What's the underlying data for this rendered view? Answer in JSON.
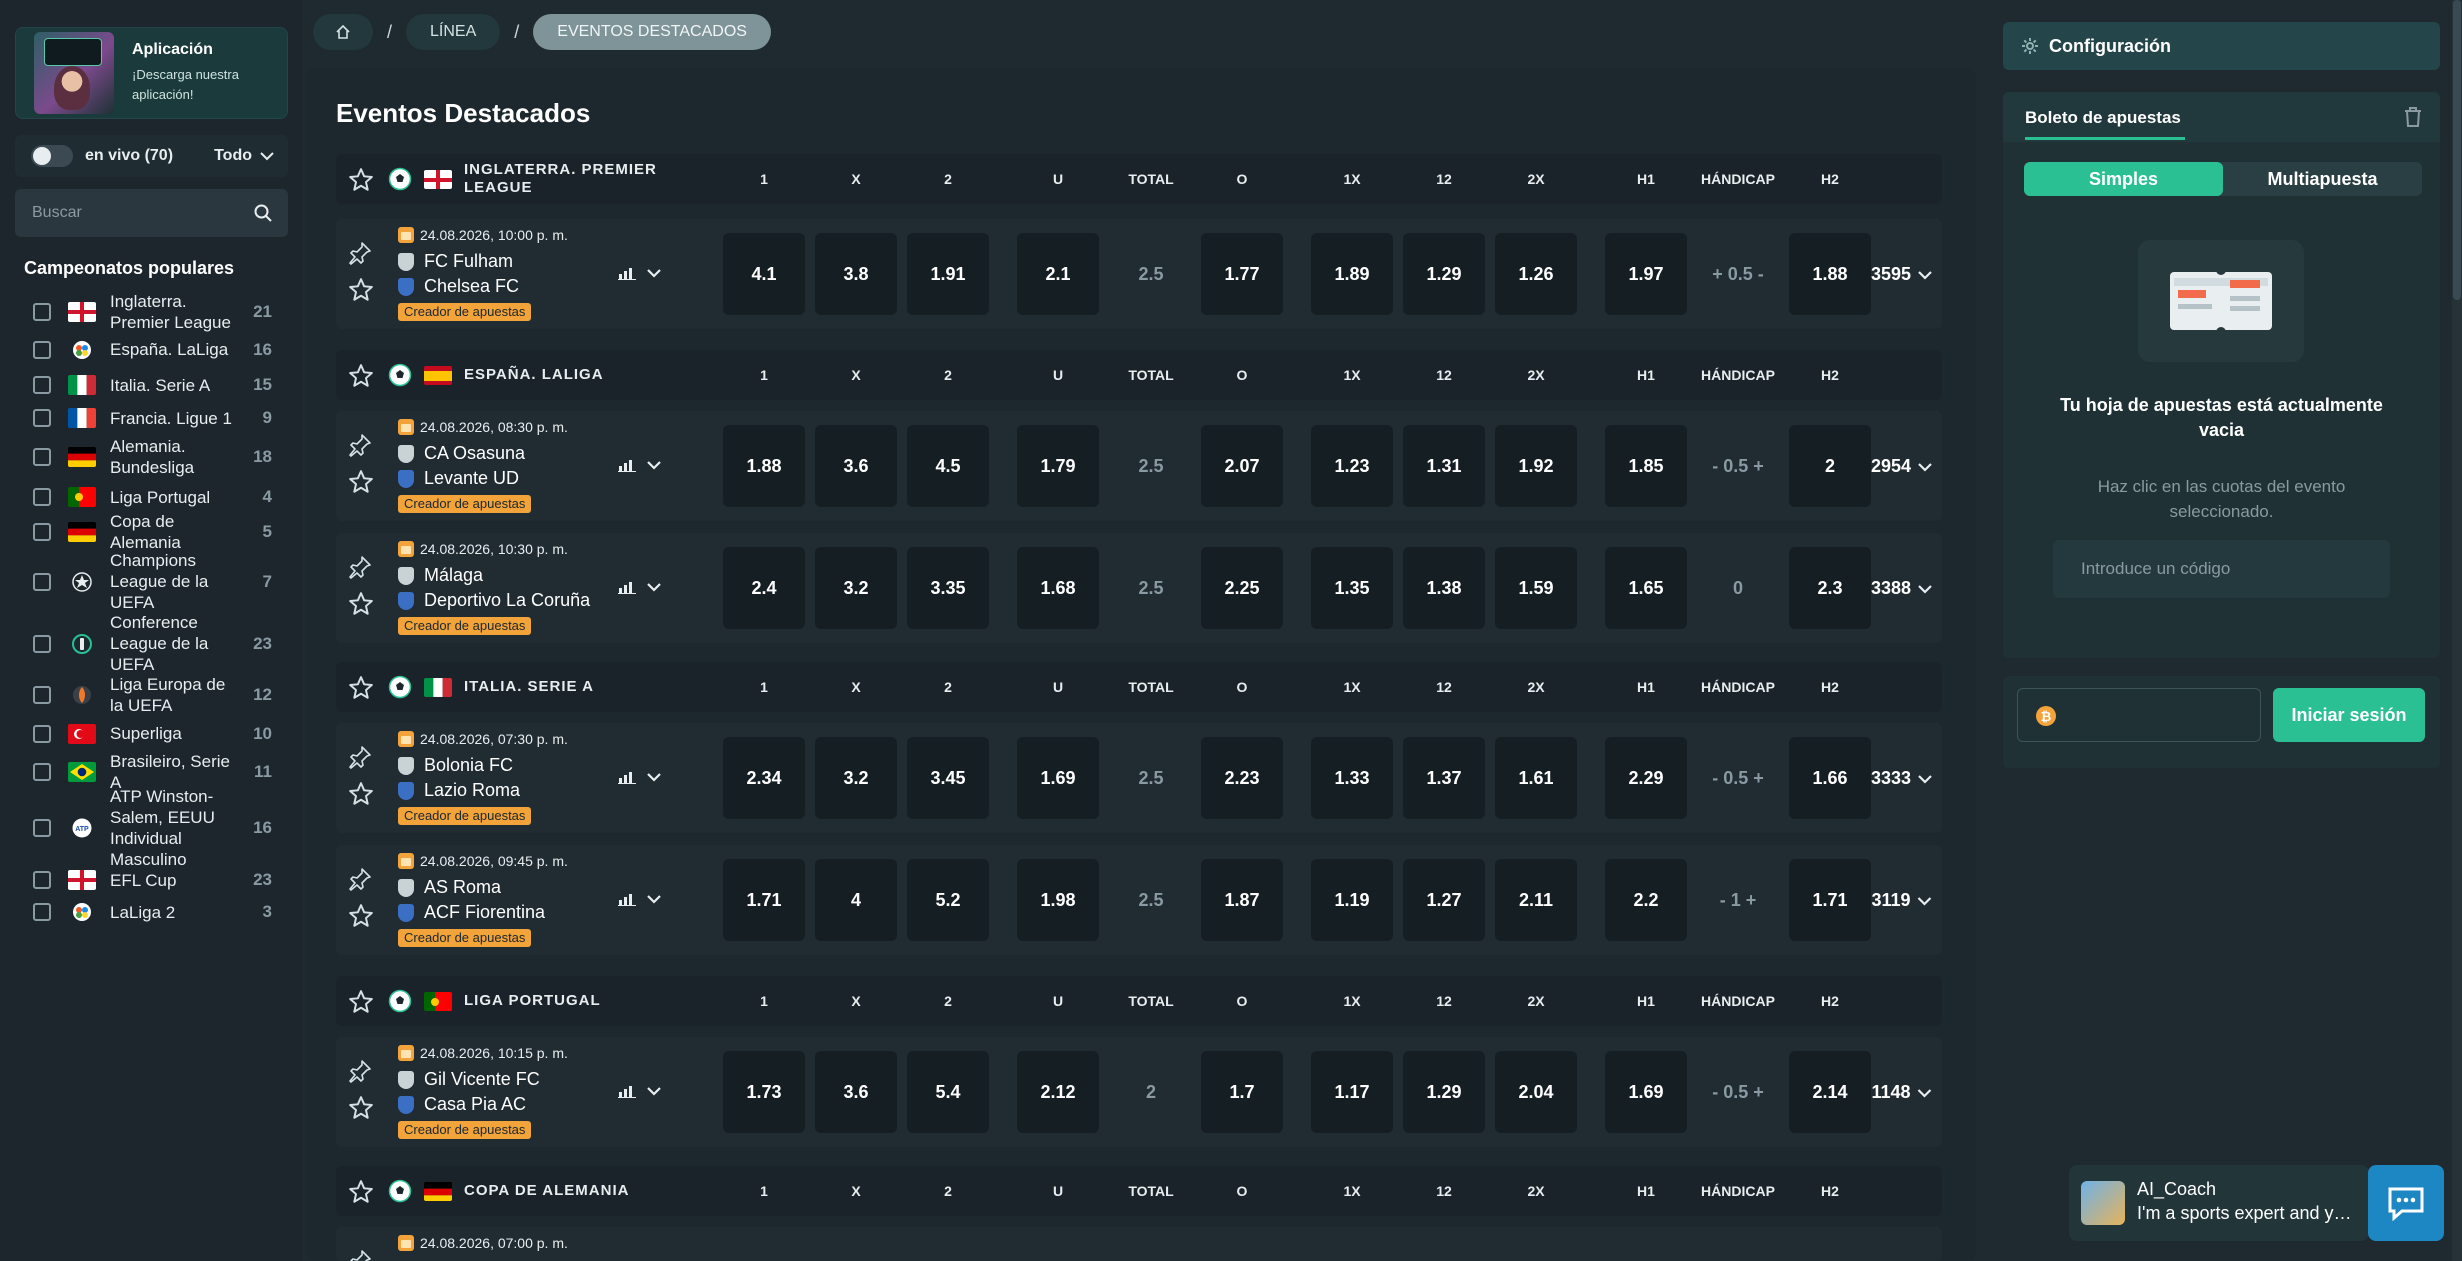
{
  "sidebar": {
    "app_title": "Aplicación",
    "app_sub": "¡Descarga nuestra aplicación!",
    "live_label": "en vivo (70)",
    "live_filter": "Todo",
    "search_placeholder": "Buscar",
    "popular_title": "Campeonatos populares",
    "items": [
      {
        "name": "Inglaterra. Premier League",
        "count": "21",
        "flag": "eng"
      },
      {
        "name": "España. LaLiga",
        "count": "16",
        "flag": "laliga"
      },
      {
        "name": "Italia. Serie A",
        "count": "15",
        "flag": "ita"
      },
      {
        "name": "Francia. Ligue 1",
        "count": "9",
        "flag": "fra"
      },
      {
        "name": "Alemania. Bundesliga",
        "count": "18",
        "flag": "ger"
      },
      {
        "name": "Liga Portugal",
        "count": "4",
        "flag": "por"
      },
      {
        "name": "Copa de Alemania",
        "count": "5",
        "flag": "ger"
      },
      {
        "name": "Champions League de la UEFA",
        "count": "7",
        "flag": "ucl"
      },
      {
        "name": "Conference League de la UEFA",
        "count": "23",
        "flag": "uecl"
      },
      {
        "name": "Liga Europa de la UEFA",
        "count": "12",
        "flag": "uel"
      },
      {
        "name": "Superliga",
        "count": "10",
        "flag": "tur"
      },
      {
        "name": "Brasileiro, Serie A",
        "count": "11",
        "flag": "bra"
      },
      {
        "name": "ATP Winston-Salem, EEUU Individual Masculino",
        "count": "16",
        "flag": "atp"
      },
      {
        "name": "EFL Cup",
        "count": "23",
        "flag": "eng"
      },
      {
        "name": "LaLiga 2",
        "count": "3",
        "flag": "laliga"
      }
    ]
  },
  "breadcrumb": {
    "line": "LÍNEA",
    "current": "EVENTOS DESTACADOS",
    "sep": "/"
  },
  "main": {
    "title": "Eventos Destacados",
    "columns": [
      "1",
      "X",
      "2",
      "U",
      "TOTAL",
      "O",
      "1X",
      "12",
      "2X",
      "H1",
      "HÁNDICAP",
      "H2"
    ],
    "bet_builder": "Creador de apuestas",
    "leagues": [
      {
        "name": "INGLATERRA. PREMIER LEAGUE",
        "flag": "eng",
        "events": [
          {
            "date": "24.08.2026, 10:00 p. m.",
            "home": "FC Fulham",
            "away": "Chelsea FC",
            "odds": [
              "4.1",
              "3.8",
              "1.91",
              "2.1",
              "2.5",
              "1.77",
              "1.89",
              "1.29",
              "1.26",
              "1.97",
              "+ 0.5 -",
              "1.88"
            ],
            "more": "3595"
          }
        ]
      },
      {
        "name": "ESPAÑA. LALIGA",
        "flag": "esp",
        "events": [
          {
            "date": "24.08.2026, 08:30 p. m.",
            "home": "CA Osasuna",
            "away": "Levante UD",
            "odds": [
              "1.88",
              "3.6",
              "4.5",
              "1.79",
              "2.5",
              "2.07",
              "1.23",
              "1.31",
              "1.92",
              "1.85",
              "- 0.5 +",
              "2"
            ],
            "more": "2954"
          },
          {
            "date": "24.08.2026, 10:30 p. m.",
            "home": "Málaga",
            "away": "Deportivo La Coruña",
            "odds": [
              "2.4",
              "3.2",
              "3.35",
              "1.68",
              "2.5",
              "2.25",
              "1.35",
              "1.38",
              "1.59",
              "1.65",
              "0",
              "2.3"
            ],
            "more": "3388"
          }
        ]
      },
      {
        "name": "ITALIA. SERIE A",
        "flag": "ita",
        "events": [
          {
            "date": "24.08.2026, 07:30 p. m.",
            "home": "Bolonia FC",
            "away": "Lazio Roma",
            "odds": [
              "2.34",
              "3.2",
              "3.45",
              "1.69",
              "2.5",
              "2.23",
              "1.33",
              "1.37",
              "1.61",
              "2.29",
              "- 0.5 +",
              "1.66"
            ],
            "more": "3333"
          },
          {
            "date": "24.08.2026, 09:45 p. m.",
            "home": "AS Roma",
            "away": "ACF Fiorentina",
            "odds": [
              "1.71",
              "4",
              "5.2",
              "1.98",
              "2.5",
              "1.87",
              "1.19",
              "1.27",
              "2.11",
              "2.2",
              "- 1 +",
              "1.71"
            ],
            "more": "3119"
          }
        ]
      },
      {
        "name": "LIGA PORTUGAL",
        "flag": "por",
        "events": [
          {
            "date": "24.08.2026, 10:15 p. m.",
            "home": "Gil Vicente FC",
            "away": "Casa Pia AC",
            "odds": [
              "1.73",
              "3.6",
              "5.4",
              "2.12",
              "2",
              "1.7",
              "1.17",
              "1.29",
              "2.04",
              "1.69",
              "- 0.5 +",
              "2.14"
            ],
            "more": "1148"
          }
        ]
      },
      {
        "name": "COPA DE ALEMANIA",
        "flag": "ger",
        "events": [
          {
            "date": "24.08.2026, 07:00 p. m.",
            "home": "",
            "away": "",
            "odds": [],
            "more": ""
          }
        ]
      }
    ]
  },
  "right": {
    "config_label": "Configuración",
    "slip_tab": "Boleto de apuestas",
    "seg_single": "Simples",
    "seg_multi": "Multiapuesta",
    "empty_title": "Tu hoja de apuestas está actualmente vacia",
    "empty_sub": "Haz clic en las cuotas del evento seleccionado.",
    "code_placeholder": "Introduce un código",
    "login_label": "Iniciar sesión",
    "btc_symbol": "₿"
  },
  "coach": {
    "name": "AI_Coach",
    "msg": "I'm a sports expert and your personal AI coach"
  },
  "colors": {
    "accent": "#2bbf94",
    "builder": "#f2a33a",
    "chat": "#1d87c4"
  }
}
